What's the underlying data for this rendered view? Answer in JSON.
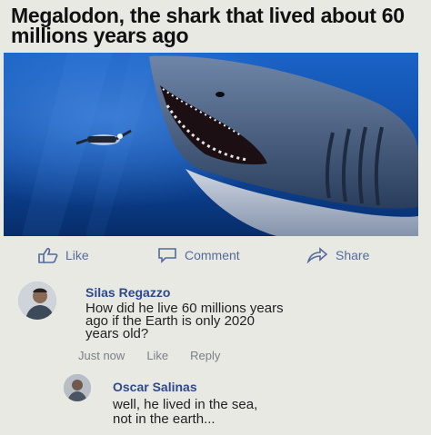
{
  "post": {
    "title": "Megalodon, the shark that lived about 60 millions years ago",
    "photo_icon": "megalodon-diver-photo"
  },
  "actions": {
    "like": "Like",
    "comment": "Comment",
    "share": "Share"
  },
  "comments": [
    {
      "author": "Silas Regazzo",
      "text_line1": "How did he live 60 millions years",
      "text_line2": "ago if the Earth is only 2020",
      "text_line3": "years old?",
      "time": "Just now",
      "like": "Like",
      "reply": "Reply"
    },
    {
      "author": "Oscar Salinas",
      "text_line1": "well, he lived in the sea,",
      "text_line2": "not in the earth..."
    }
  ],
  "colors": {
    "link": "#2e4a8a",
    "action": "#566a9a",
    "ocean": "#0b3f8c"
  }
}
